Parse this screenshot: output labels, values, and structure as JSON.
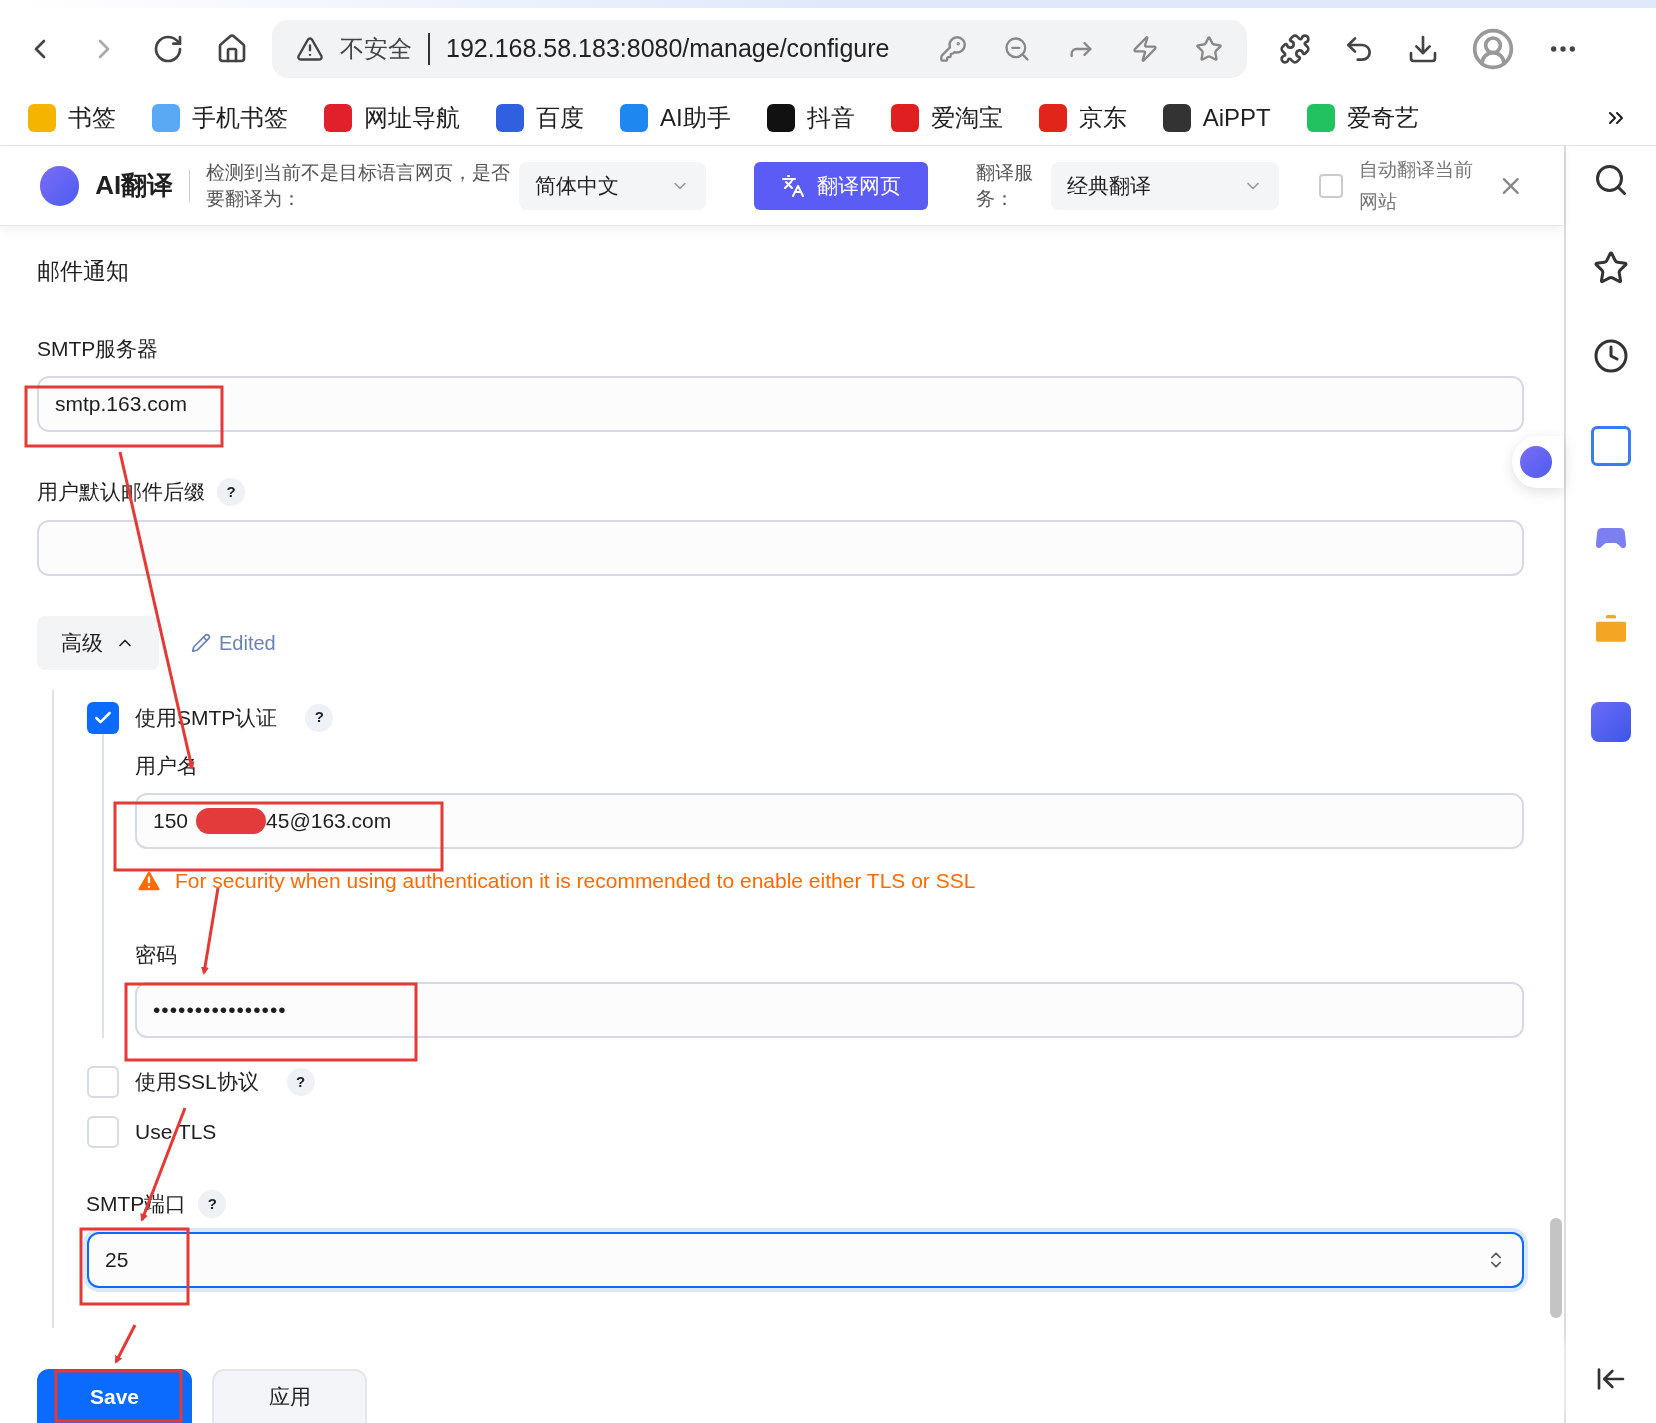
{
  "browser": {
    "security_label": "不安全",
    "url": "192.168.58.183:8080/manage/configure"
  },
  "bookmarks": [
    {
      "label": "书签",
      "color": "#f5b400"
    },
    {
      "label": "手机书签",
      "color": "#5aa9f5"
    },
    {
      "label": "网址导航",
      "color": "#e0202a"
    },
    {
      "label": "百度",
      "color": "#3060e0"
    },
    {
      "label": "AI助手",
      "color": "#1e88f0"
    },
    {
      "label": "抖音",
      "color": "#111111"
    },
    {
      "label": "爱淘宝",
      "color": "#e02020"
    },
    {
      "label": "京东",
      "color": "#e1251b"
    },
    {
      "label": "AiPPT",
      "color": "#333333"
    },
    {
      "label": "爱奇艺",
      "color": "#22c35e"
    }
  ],
  "translate_bar": {
    "brand": "AI翻译",
    "prompt": "检测到当前不是目标语言网页，是否要翻译为：",
    "language": "简体中文",
    "translate_button": "翻译网页",
    "service_label": "翻译服务：",
    "service": "经典翻译",
    "auto_translate": {
      "label": "自动翻译当前网站",
      "checked": false
    }
  },
  "section_title": "邮件通知",
  "smtp_server": {
    "label": "SMTP服务器",
    "value": "smtp.163.com"
  },
  "default_suffix": {
    "label": "用户默认邮件后缀",
    "help": "?"
  },
  "advanced": {
    "label": "高级",
    "expanded": true,
    "edited_label": "Edited"
  },
  "smtp_auth": {
    "label": "使用SMTP认证",
    "help": "?",
    "checked": true,
    "username": {
      "label": "用户名",
      "value_start": "150",
      "value_end": "45@163.com"
    },
    "warning": "For security when using authentication it is recommended to enable either TLS or SSL",
    "password": {
      "label": "密码",
      "value": "••••••••••••••••"
    }
  },
  "options": [
    {
      "label": "使用SSL协议",
      "help": "?",
      "checked": false
    },
    {
      "label": "Use TLS",
      "checked": false
    }
  ],
  "smtp_port": {
    "label": "SMTP端口",
    "help": "?",
    "value": "25",
    "focused": true
  },
  "actions": [
    {
      "label": "Save",
      "kind": "primary"
    },
    {
      "label": "应用",
      "kind": "secondary"
    }
  ]
}
